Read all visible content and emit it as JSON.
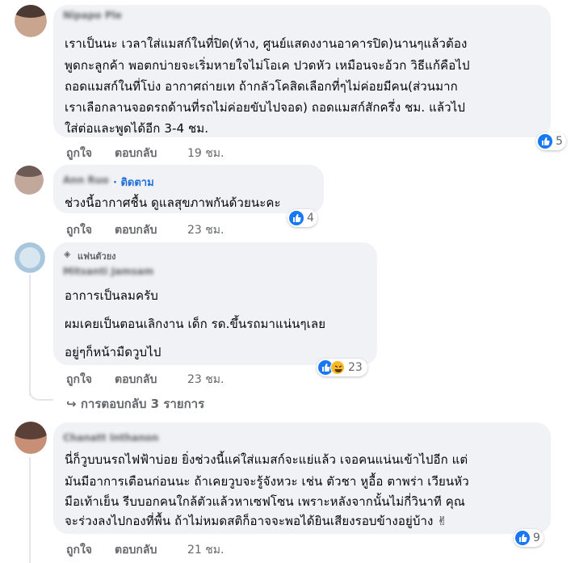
{
  "comments": [
    {
      "author": "Nipapo Ple",
      "lines": [
        "เราเป็นนะ เวลาใส่แมสก์ในที่ปิด(ห้าง, ศูนย์แสดงงานอาคารปิด)นานๆแล้วต้อง",
        "พูดกะลูกค้า พอตกบ่ายจะเริ่มหายใจไม่โอเค ปวดหัว เหมือนจะอ้วก วิธีแก้คือไป",
        "ถอดแมสก์ในที่โบ่ง อากาศถ่ายเท ถ้ากลัวโคสิดเลือกที่ๆไม่ค่อยมีคน(ส่วนมาก",
        "เราเลือกลานจอดรถด้านที่รถไม่ค่อยขับไปจอด) ถอดแมสก์สักครึ่ง ชม. แล้วไป",
        "ใส่ต่อและพูดได้อีก 3-4 ชม."
      ],
      "like": "ถูกใจ",
      "reply": "ตอบกลับ",
      "time": "19 ชม.",
      "reaction_count": "5"
    },
    {
      "author": "Ann Ruo",
      "follow": "ติดตาม",
      "lines": [
        "ช่วงนี้อากาศชื้น ดูแลสุขภาพกันด้วยนะคะ"
      ],
      "like": "ถูกใจ",
      "reply": "ตอบกลับ",
      "time": "23 ชม.",
      "reaction_count": "4"
    },
    {
      "badge": "แฟนตัวยง",
      "author": "Mitsanti Jamsam",
      "lines": [
        "อาการเป็นลมครับ",
        "ผมเคยเป็นตอนเลิกงาน เด็ก รด.ขึ้นรถมาแน่นๆเลย",
        "อยู่ๆก็หน้ามืดวูบไป"
      ],
      "like": "ถูกใจ",
      "reply": "ตอบกลับ",
      "time": "23 ชม.",
      "reaction_count": "23"
    },
    {
      "author": "Chanatt Inthanon",
      "lines": [
        "นี่ก็วูบบนรถไฟฟ้าบ่อย ยิ่งช่วงนี้แค่ใส่แมสก์จะแย่แล้ว เจอคนแน่นเข้าไปอีก แต่",
        "มันมีอาการเตือนก่อนนะ ถ้าเคยวูบจะรู้จังหวะ เช่น ตัวชา หูอื้อ ตาพร่า เวียนหัว",
        "มือเท้าเย็น รีบบอกคนใกล้ตัวแล้วหาเซฟโซน เพราะหลังจากนั้นไม่กี่วินาที คุณ",
        "จะร่วงลงไปกองที่พื้น ถ้าไม่หมดสติก็อาจจะพอได้ยินเสียงรอบข้างอยู่บ้าง ✌"
      ],
      "like": "ถูกใจ",
      "reply": "ตอบกลับ",
      "time": "21 ชม.",
      "reaction_count": "9"
    }
  ],
  "view_replies": "การตอบกลับ 3 รายการ",
  "colors": {
    "like_blue": "#1877f2",
    "haha_yellow": "#f7b928",
    "bubble_bg": "#f0f2f5",
    "meta_gray": "#65676b",
    "follow_blue": "#216fdb"
  }
}
